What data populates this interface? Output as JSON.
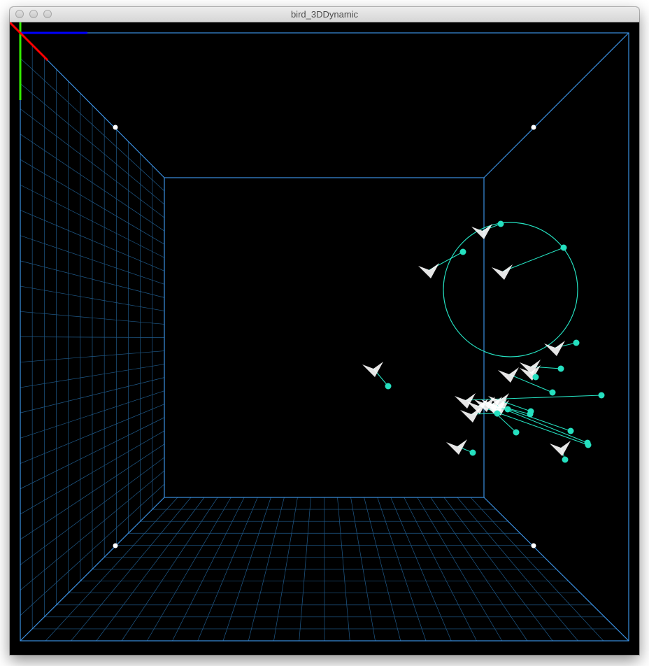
{
  "window": {
    "title": "bird_3DDynamic",
    "buttons": [
      "close",
      "minimize",
      "zoom"
    ]
  },
  "scene": {
    "background": "#000000",
    "room_line_color": "#3a8fe0",
    "grid_color": "#1f5a8a",
    "accent_color": "#25e0c0",
    "bird_color": "#ffffff",
    "axis_colors": {
      "x": "#0000ff",
      "y": "#33ee00",
      "z": "#ff0000"
    },
    "bird_count": 19
  }
}
